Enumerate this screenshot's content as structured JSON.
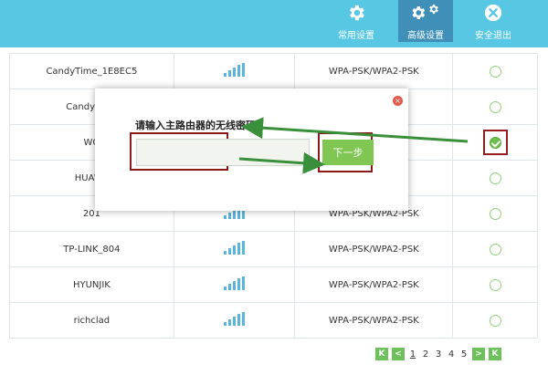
{
  "header": {
    "nav": [
      {
        "label": "常用设置",
        "icon": "gear-icon"
      },
      {
        "label": "高级设置",
        "icon": "gears-icon"
      },
      {
        "label": "安全退出",
        "icon": "close-circle-icon"
      }
    ]
  },
  "table": {
    "rows": [
      {
        "ssid": "CandyTime_1E8EC5",
        "security": "WPA-PSK/WPA2-PSK",
        "selected": false
      },
      {
        "ssid": "CandyTime",
        "security": "SK",
        "selected": false
      },
      {
        "ssid": "WO",
        "security": "SK",
        "selected": true
      },
      {
        "ssid": "HUAWE",
        "security": "SK",
        "selected": false
      },
      {
        "ssid": "201",
        "security": "WPA-PSK/WPA2-PSK",
        "selected": false
      },
      {
        "ssid": "TP-LINK_804",
        "security": "WPA-PSK/WPA2-PSK",
        "selected": false
      },
      {
        "ssid": "HYUNJIK",
        "security": "WPA-PSK/WPA2-PSK",
        "selected": false
      },
      {
        "ssid": "richclad",
        "security": "WPA-PSK/WPA2-PSK",
        "selected": false
      }
    ]
  },
  "pagination": {
    "first": "K",
    "prev": "<",
    "pages": [
      "1",
      "2",
      "3",
      "4",
      "5"
    ],
    "current_page": "1",
    "next": ">",
    "last": "K"
  },
  "modal": {
    "close": "×",
    "title": "请输入主路由器的无线密码",
    "password_value": "",
    "next_button": "下一步"
  },
  "colors": {
    "header_bg": "#57c7e3",
    "active_nav_bg": "#3f8fb8",
    "accent_green": "#80c653",
    "annotation_red": "#8b1a1a",
    "arrow_green": "#3a8f3a"
  }
}
